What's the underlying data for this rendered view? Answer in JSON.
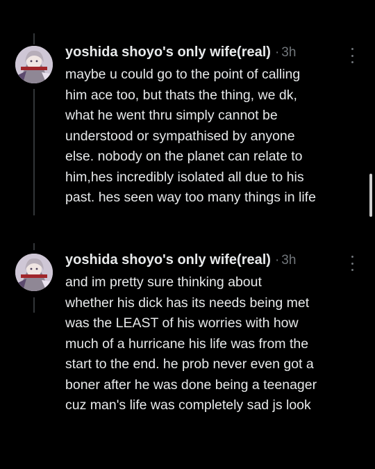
{
  "posts": [
    {
      "author": "yoshida shoyo's only wife(real)",
      "separator": "·",
      "time": "3h",
      "body": "maybe u could go to the point of calling\nhim ace too, but thats the thing, we dk,\nwhat he went thru simply cannot be\nunderstood or sympathised by anyone\nelse. nobody on the planet can relate to\nhim,hes incredibly isolated all due to his\npast. hes seen way too many things in life"
    },
    {
      "author": "yoshida shoyo's only wife(real)",
      "separator": "·",
      "time": "3h",
      "body": "and im pretty sure thinking about\nwhether his dick has its needs being met\nwas the LEAST of his worries with how\nmuch of a hurricane his life was from the\nstart to the end. he prob never even got a\nboner after he was done being a teenager\ncuz man's life was completely sad js look"
    }
  ],
  "colors": {
    "background": "#000000",
    "text": "#e7e9ea",
    "muted": "#71767b",
    "thread_line": "#333639"
  },
  "icons": {
    "more": "more-vertical-icon",
    "avatar": "avatar-anime-character"
  }
}
